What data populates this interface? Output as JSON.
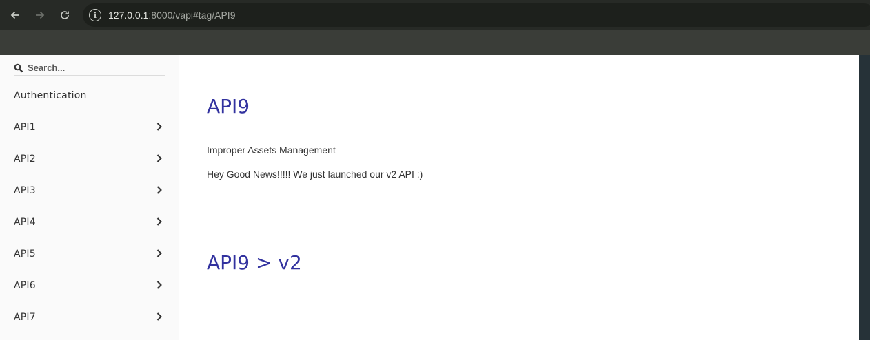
{
  "browser": {
    "url_host": "127.0.0.1",
    "url_path": ":8000/vapi#tag/API9"
  },
  "sidebar": {
    "search_placeholder": "Search...",
    "items": [
      {
        "label": "Authentication",
        "has_chevron": false
      },
      {
        "label": "API1",
        "has_chevron": true
      },
      {
        "label": "API2",
        "has_chevron": true
      },
      {
        "label": "API3",
        "has_chevron": true
      },
      {
        "label": "API4",
        "has_chevron": true
      },
      {
        "label": "API5",
        "has_chevron": true
      },
      {
        "label": "API6",
        "has_chevron": true
      },
      {
        "label": "API7",
        "has_chevron": true
      }
    ]
  },
  "main": {
    "heading": "API9",
    "description_1": "Improper Assets Management",
    "description_2": "Hey Good News!!!!! We just launched our v2 API :)",
    "subheading": "API9 > v2"
  },
  "colors": {
    "heading": "#32329f",
    "sidebar_bg": "#fafafa",
    "right_panel": "#263238"
  }
}
